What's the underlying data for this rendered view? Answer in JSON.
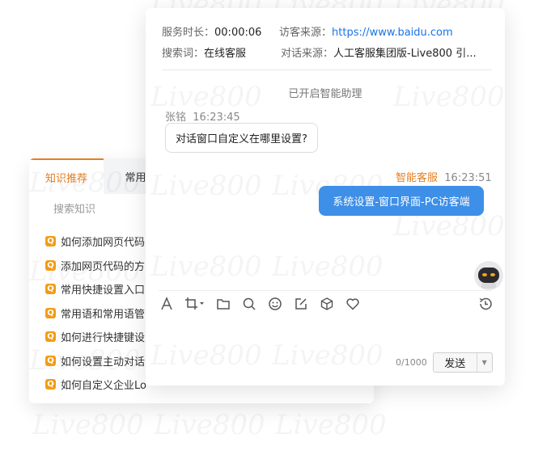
{
  "watermark": "Live800",
  "knowledge": {
    "tabs": [
      "知识推荐",
      "常用语"
    ],
    "search_placeholder": "搜索知识",
    "items": [
      "如何添加网页代码",
      "添加网页代码的方",
      "常用快捷设置入口",
      "常用语和常用语管",
      "如何进行快捷键设",
      "如何设置主动对话",
      "如何自定义企业Lo"
    ]
  },
  "chat": {
    "info": {
      "duration_label": "服务时长：",
      "duration_value": "00:00:06",
      "source_label": "访客来源：",
      "source_value": "https://www.baidu.com",
      "keyword_label": "搜索词：",
      "keyword_value": "在线客服",
      "dialog_source_label": "对话来源：",
      "dialog_source_value": "人工客服集团版-Live800 引..."
    },
    "system_message": "已开启智能助理",
    "visitor_message": {
      "name": "张铭",
      "time": "16:23:45",
      "text": "对话窗口自定义在哪里设置?"
    },
    "bot_message": {
      "name": "智能客服",
      "time": "16:23:51",
      "text": "系统设置-窗口界面-PC访客端"
    },
    "toolbar_icons": [
      "font-icon",
      "crop-icon",
      "folder-icon",
      "search-icon",
      "emoji-icon",
      "edit-icon",
      "cube-icon",
      "heart-icon",
      "history-icon"
    ],
    "char_count": "0/1000",
    "send_label": "发送"
  },
  "colors": {
    "accent": "#e67e22",
    "bubble": "#3d8fe8",
    "link": "#1a73e8"
  }
}
